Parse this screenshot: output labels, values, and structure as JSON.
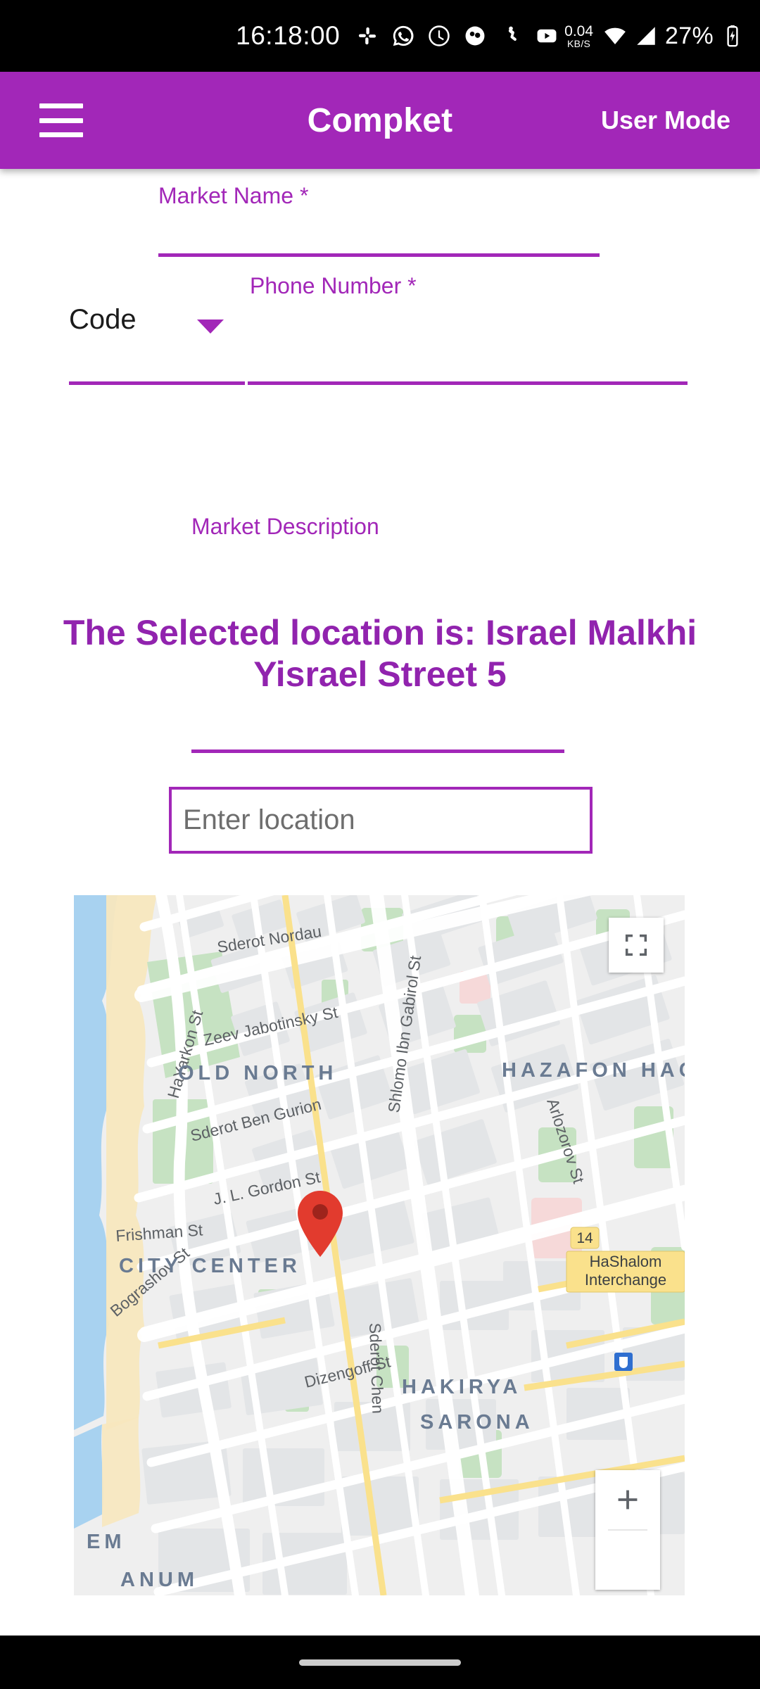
{
  "status_bar": {
    "clock": "16:18:00",
    "icons": [
      "slack-icon",
      "whatsapp-icon",
      "clock-app-icon",
      "photos-icon",
      "gallery-icon",
      "youtube-icon"
    ],
    "net_speed_value": "0.04",
    "net_speed_unit": "KB/S",
    "wifi_icon": "wifi-icon",
    "signal_icon": "cellular-signal-icon",
    "battery_percent": "27%",
    "battery_icon": "battery-charging-icon"
  },
  "app_bar": {
    "menu_icon": "hamburger-menu-icon",
    "title": "Compket",
    "user_mode_label": "User Mode",
    "background_color": "#A227B8",
    "text_color": "#FFFFFF"
  },
  "form": {
    "market_name": {
      "label": "Market Name *",
      "value": "",
      "required": true
    },
    "code": {
      "label": "Code",
      "value": "Code",
      "dropdown_icon": "chevron-down-icon"
    },
    "phone_number": {
      "label": "Phone Number *",
      "value": "",
      "required": true
    },
    "market_description": {
      "label": "Market Description",
      "value": ""
    },
    "accent_color": "#A227B8"
  },
  "location": {
    "heading_prefix": "The Selected location is:",
    "selected_address": "Israel Malkhi Yisrael Street 5",
    "heading_full": "The Selected location is: Israel Malkhi Yisrael Street 5",
    "heading_color": "#9123AE",
    "input_placeholder": "Enter location",
    "input_value": ""
  },
  "map": {
    "fullscreen_icon": "fullscreen-icon",
    "zoom_in_label": "+",
    "marker": {
      "icon": "map-pin-icon",
      "color": "#E23B2E"
    },
    "streets": [
      "Sderot Nordau",
      "HaYarkon St",
      "Zeev Jabotinsky St",
      "Shlomo Ibn Gabirol St",
      "Sderot Ben Gurion",
      "J. L. Gordon St",
      "Frishman St",
      "Bograshov St",
      "Sderot Chen",
      "Dizengoff St",
      "Arlozorov St"
    ],
    "neighborhoods": [
      "OLD NORTH",
      "HAZAFON HACHADASH",
      "CITY CENTER",
      "HAKIRYA",
      "SARONA",
      "EM",
      "ANUM"
    ],
    "poi": [
      {
        "badge": "14",
        "label_line1": "HaShalom",
        "label_line2": "Interchange"
      }
    ],
    "colors": {
      "water": "#A8D2F0",
      "sand": "#F7E7BE",
      "park": "#C6E2C2",
      "building": "#E3E5E7",
      "road": "#FFFFFF",
      "highway": "#FAE18C",
      "land": "#EFEFEF"
    }
  },
  "nav_bar": {
    "home_indicator": "home-indicator"
  }
}
